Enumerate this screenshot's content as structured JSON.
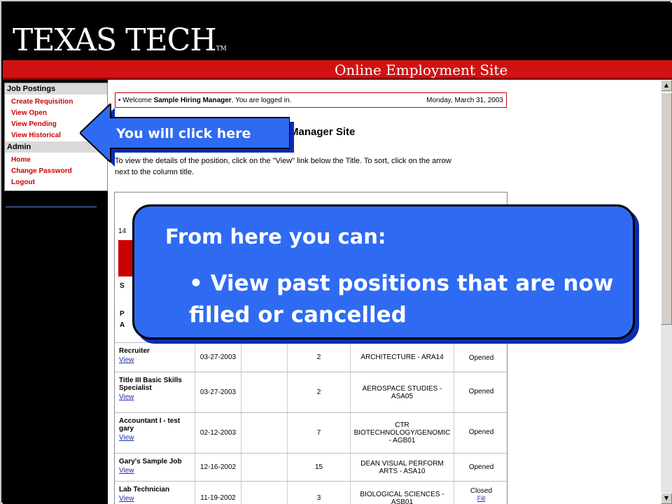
{
  "header": {
    "logo_text": "TEXAS TECH",
    "logo_tm": "TM",
    "banner_title": "Online Employment Site"
  },
  "sidebar": {
    "sections": [
      {
        "title": "Job Postings",
        "items": [
          "Create Requisition",
          "View Open",
          "View Pending",
          "View Historical"
        ]
      },
      {
        "title": "Admin",
        "items": [
          "Home",
          "Change Password",
          "Logout"
        ]
      }
    ]
  },
  "main": {
    "welcome_prefix": "Welcome ",
    "welcome_user": "Sample Hiring Manager",
    "welcome_suffix": ". You are logged in.",
    "date": "Monday, March 31, 2003",
    "page_heading": "Manager Site",
    "intro_line1": "To view the details of the position, click on the \"View\" link below the Title. To sort, click on the arrow",
    "intro_line2": "next to the column title.",
    "fragments": [
      "14",
      "S",
      "P",
      "A"
    ],
    "view_label": "View",
    "rows": [
      {
        "title": "Recruiter",
        "date": "03-27-2003",
        "count": "2",
        "dept": "ARCHITECTURE - ARA14",
        "status": "Opened"
      },
      {
        "title": "Title III Basic Skills Specialist",
        "date": "03-27-2003",
        "count": "2",
        "dept": "AEROSPACE STUDIES - ASA05",
        "status": "Opened"
      },
      {
        "title": "Accountant I - test gary",
        "date": "02-12-2003",
        "count": "7",
        "dept": "CTR BIOTECHNOLOGY/GENOMIC - AGB01",
        "status": "Opened"
      },
      {
        "title": "Gary's Sample Job",
        "date": "12-16-2002",
        "count": "15",
        "dept": "DEAN VISUAL PERFORM ARTS - ASA10",
        "status": "Opened"
      },
      {
        "title": "Lab Technician",
        "date": "11-19-2002",
        "count": "3",
        "dept": "BIOLOGICAL SCIENCES - ASB01",
        "status": "Closed",
        "status_link": "Fill"
      }
    ]
  },
  "annotation": {
    "arrow_label": "You will click here",
    "callout_heading": "From here you can:",
    "callout_bullet": "• View past positions that are now  filled or cancelled"
  },
  "colors": {
    "brand_red": "#d01212",
    "callout_blue": "#2f6bf2",
    "link_blue": "#1c2fa6"
  }
}
